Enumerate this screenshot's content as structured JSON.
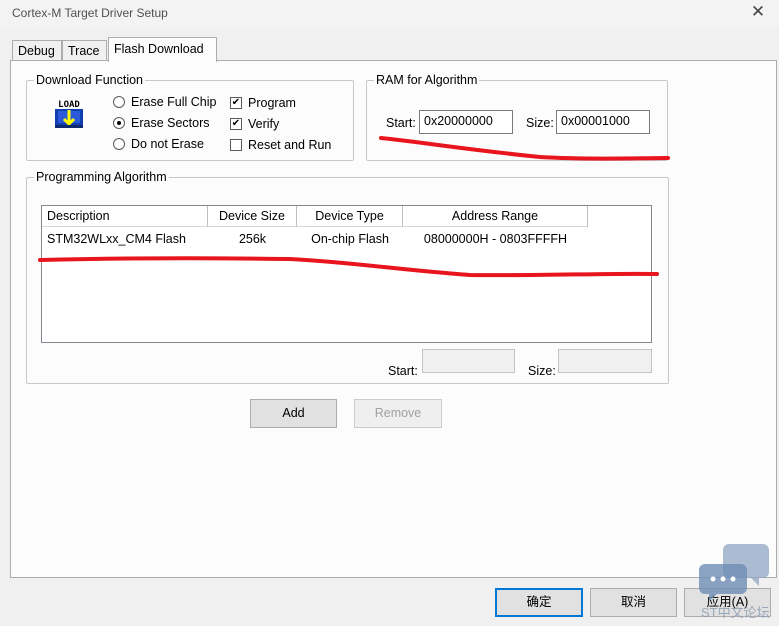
{
  "window": {
    "title": "Cortex-M Target Driver Setup",
    "close_glyph": "✕"
  },
  "tabs": [
    {
      "label": "Debug"
    },
    {
      "label": "Trace"
    },
    {
      "label": "Flash Download"
    }
  ],
  "download_function": {
    "legend": "Download Function",
    "icon_text": "LOAD",
    "erase_options": [
      {
        "label": "Erase Full Chip",
        "selected": false
      },
      {
        "label": "Erase Sectors",
        "selected": true
      },
      {
        "label": "Do not Erase",
        "selected": false
      }
    ],
    "checkboxes": [
      {
        "label": "Program",
        "checked": true
      },
      {
        "label": "Verify",
        "checked": true
      },
      {
        "label": "Reset and Run",
        "checked": false
      }
    ]
  },
  "ram_for_algorithm": {
    "legend": "RAM for Algorithm",
    "start_label": "Start:",
    "start_value": "0x20000000",
    "size_label": "Size:",
    "size_value": "0x00001000"
  },
  "programming_algorithm": {
    "legend": "Programming Algorithm",
    "columns": [
      "Description",
      "Device Size",
      "Device Type",
      "Address Range"
    ],
    "rows": [
      {
        "description": "STM32WLxx_CM4 Flash",
        "device_size": "256k",
        "device_type": "On-chip Flash",
        "address_range": "08000000H - 0803FFFFH"
      }
    ],
    "start_label": "Start:",
    "start_value": "",
    "size_label": "Size:",
    "size_value": ""
  },
  "buttons": {
    "add": "Add",
    "remove": "Remove",
    "ok": "确定",
    "cancel": "取消",
    "apply": "应用(A)"
  },
  "watermark": {
    "text": "ST中文论坛"
  },
  "colors": {
    "annotation_red": "#e8141e",
    "accent_blue": "#0078d7"
  }
}
